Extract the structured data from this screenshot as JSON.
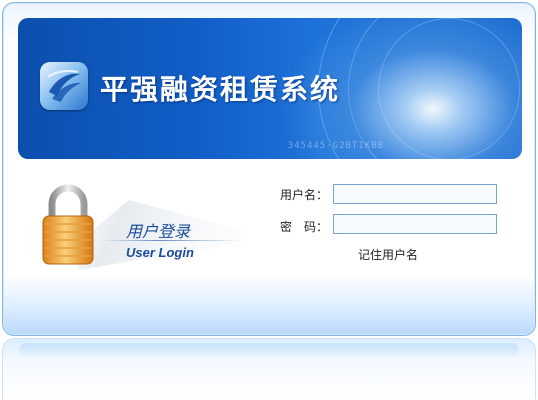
{
  "banner": {
    "title": "平强融资租赁系统",
    "deco_text": "345445·G2BTIKBB"
  },
  "login_badge": {
    "title_cn": "用户登录",
    "title_en": "User Login"
  },
  "form": {
    "username_label": "用户名：",
    "username_value": "",
    "password_label": "密　码：",
    "password_value": "",
    "remember_label": "记住用户名"
  },
  "colors": {
    "banner_blue": "#115ec6",
    "accent_text": "#1b4b9a",
    "input_border": "#7aa4d0"
  },
  "icons": {
    "logo": "app-logo-icon",
    "lock": "padlock-icon"
  }
}
